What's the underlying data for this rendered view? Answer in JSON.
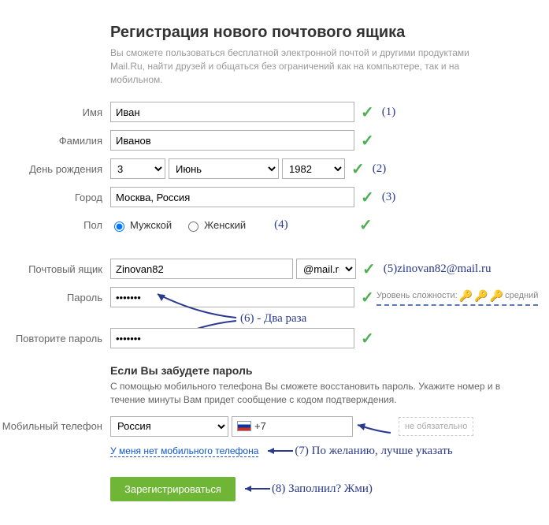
{
  "header": {
    "title": "Регистрация нового почтового ящика",
    "subtitle": "Вы сможете пользоваться бесплатной электронной почтой и другими продуктами Mail.Ru, найти друзей и общаться без ограничений как на компьютере, так и на мобильном."
  },
  "fields": {
    "firstname": {
      "label": "Имя",
      "value": "Иван"
    },
    "lastname": {
      "label": "Фамилия",
      "value": "Иванов"
    },
    "birthday": {
      "label": "День рождения",
      "day": "3",
      "month": "Июнь",
      "year": "1982"
    },
    "city": {
      "label": "Город",
      "value": "Москва, Россия"
    },
    "gender": {
      "label": "Пол",
      "male": "Мужской",
      "female": "Женский"
    },
    "mailbox": {
      "label": "Почтовый ящик",
      "value": "Zinovan82",
      "domain": "@mail.ru"
    },
    "password": {
      "label": "Пароль",
      "value": "•••••••"
    },
    "password2": {
      "label": "Повторите пароль",
      "value": "•••••••"
    },
    "phone": {
      "label": "Мобильный телефон",
      "country": "Россия",
      "prefix": "+7",
      "optional": "не обязательно"
    }
  },
  "forgot": {
    "title": "Если Вы забудете пароль",
    "desc": "С помощью мобильного телефона Вы сможете восстановить пароль. Укажите номер и в течение минуты Вам придет сообщение с кодом подтверждения."
  },
  "links": {
    "nophone": "У меня нет мобильного телефона"
  },
  "submit": "Зарегистрироваться",
  "strength": {
    "label": "Уровень сложности:",
    "value": "средний"
  },
  "annotations": {
    "a1": "(1)",
    "a2": "(2)",
    "a3": "(3)",
    "a4": "(4)",
    "a5": "(5)zinovan82@mail.ru",
    "a6": "(6) - Два раза",
    "a7": "(7) По желанию, лучше указать",
    "a8": "(8) Заполнил? Жми)"
  }
}
